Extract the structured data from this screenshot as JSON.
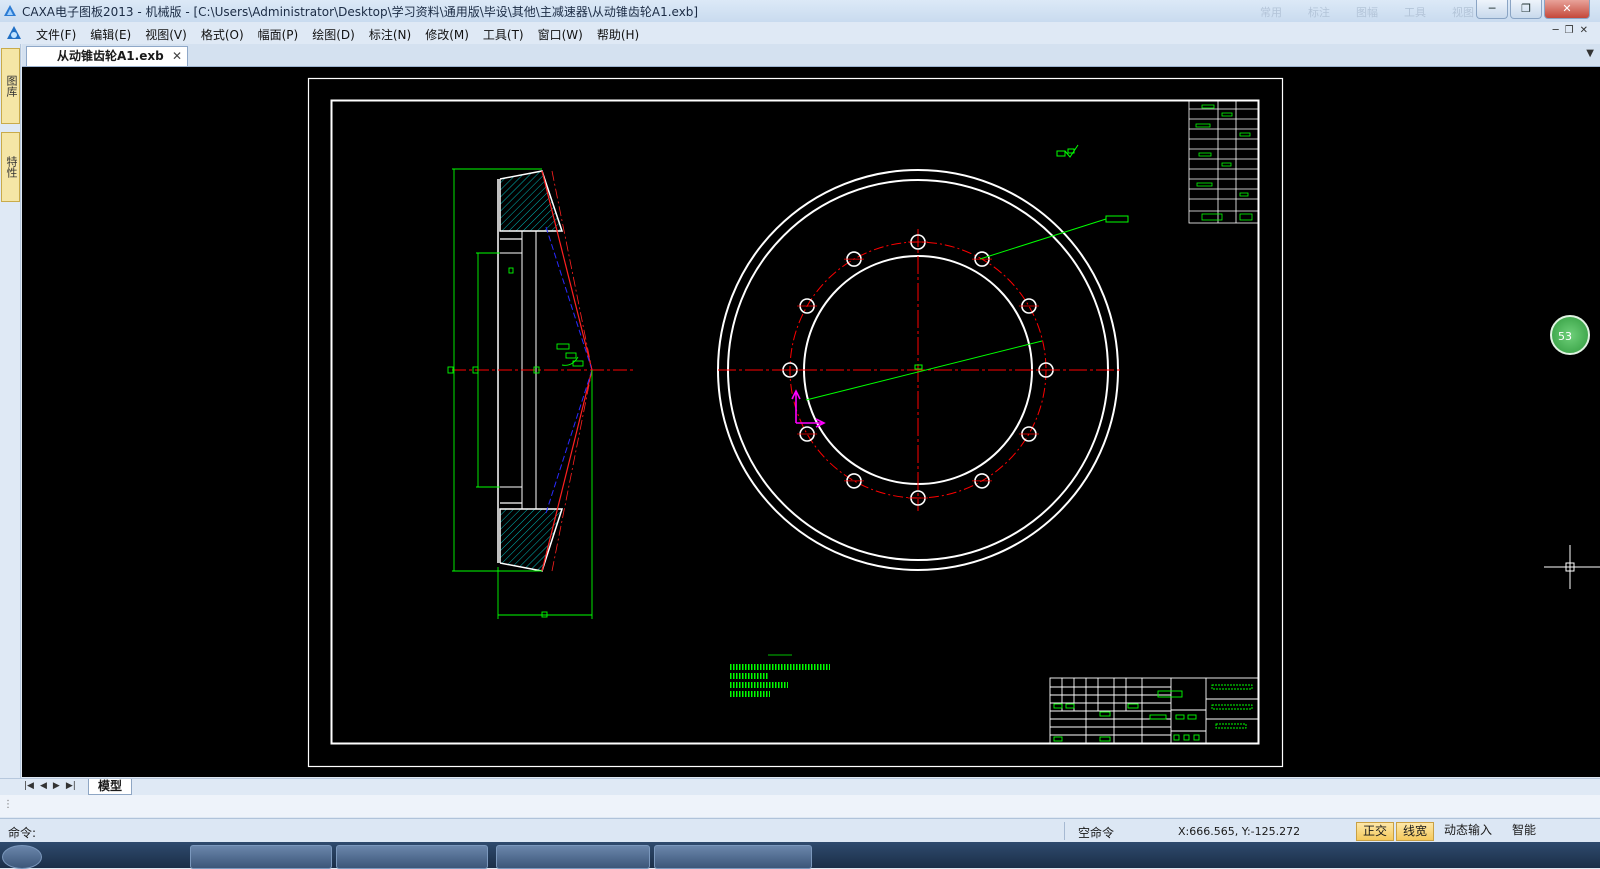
{
  "window": {
    "title": "CAXA电子图板2013 - 机械版 - [C:\\Users\\Administrator\\Desktop\\学习资料\\通用版\\毕设\\其他\\主减速器\\从动锥齿轮A1.exb]",
    "minimize": "─",
    "restore": "❐",
    "close": "✕",
    "ribbon_ghost": [
      "常用",
      "标注",
      "图幅",
      "工具",
      "视图"
    ]
  },
  "menu": {
    "items": [
      "文件(F)",
      "编辑(E)",
      "视图(V)",
      "格式(O)",
      "幅面(P)",
      "绘图(D)",
      "标注(N)",
      "修改(M)",
      "工具(T)",
      "窗口(W)",
      "帮助(H)"
    ],
    "mdi_minimize": "─",
    "mdi_restore": "❐",
    "mdi_close": "✕"
  },
  "document_tab": {
    "label": "从动锥齿轮A1.exb",
    "close": "✕",
    "dropdown": "▼"
  },
  "left_dock": {
    "tab1": "图库",
    "tab2": "特性"
  },
  "badge": "53",
  "layout_tabs": {
    "nav": [
      "|◀",
      "◀",
      "▶",
      "▶|"
    ],
    "model_tab": "模型"
  },
  "status": {
    "command_label": "命令:",
    "current_command": "空命令",
    "coordinates": "X:666.565, Y:-125.272",
    "ortho": "正交",
    "lineweight": "线宽",
    "dynamic_input": "动态输入",
    "smart": "智能"
  },
  "colors": {
    "canvas": "#000000",
    "geometry": "#ffffff",
    "centerline": "#ff0000",
    "dimension": "#00ff00",
    "hidden": "#0000ff",
    "cursor": "#ff00ff"
  }
}
